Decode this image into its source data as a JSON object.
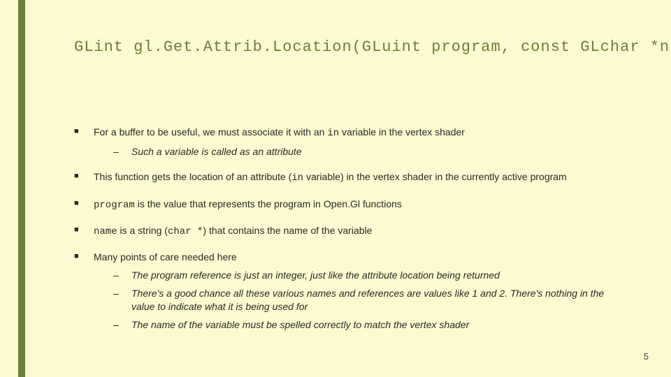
{
  "title": "GLint gl.Get.Attrib.Location(GLuint program, const GLchar *name)",
  "bullets": {
    "b1_a": "For a buffer to be useful, we must associate it with an ",
    "b1_code": "in",
    "b1_b": " variable in the vertex shader",
    "b1_sub1": "Such a variable is called as an attribute",
    "b2_a": "This function gets the location of an attribute (",
    "b2_code": "in",
    "b2_b": " variable) in the vertex shader in the currently active program",
    "b3_code": "program",
    "b3_a": " is the value that represents the program in Open.Gl functions",
    "b4_code": "name",
    "b4_a": " is a string (",
    "b4_code2": "char *",
    "b4_b": ") that contains the name of the variable",
    "b5": "Many points of care needed here",
    "b5_sub1": "The program reference is just an integer, just like the attribute location being returned",
    "b5_sub2": "There's a good chance all these various names and references are values like 1 and 2. There's nothing in the value to indicate what it is being used for",
    "b5_sub3": "The name of the variable must be spelled correctly to match the vertex shader"
  },
  "page_number": "5"
}
